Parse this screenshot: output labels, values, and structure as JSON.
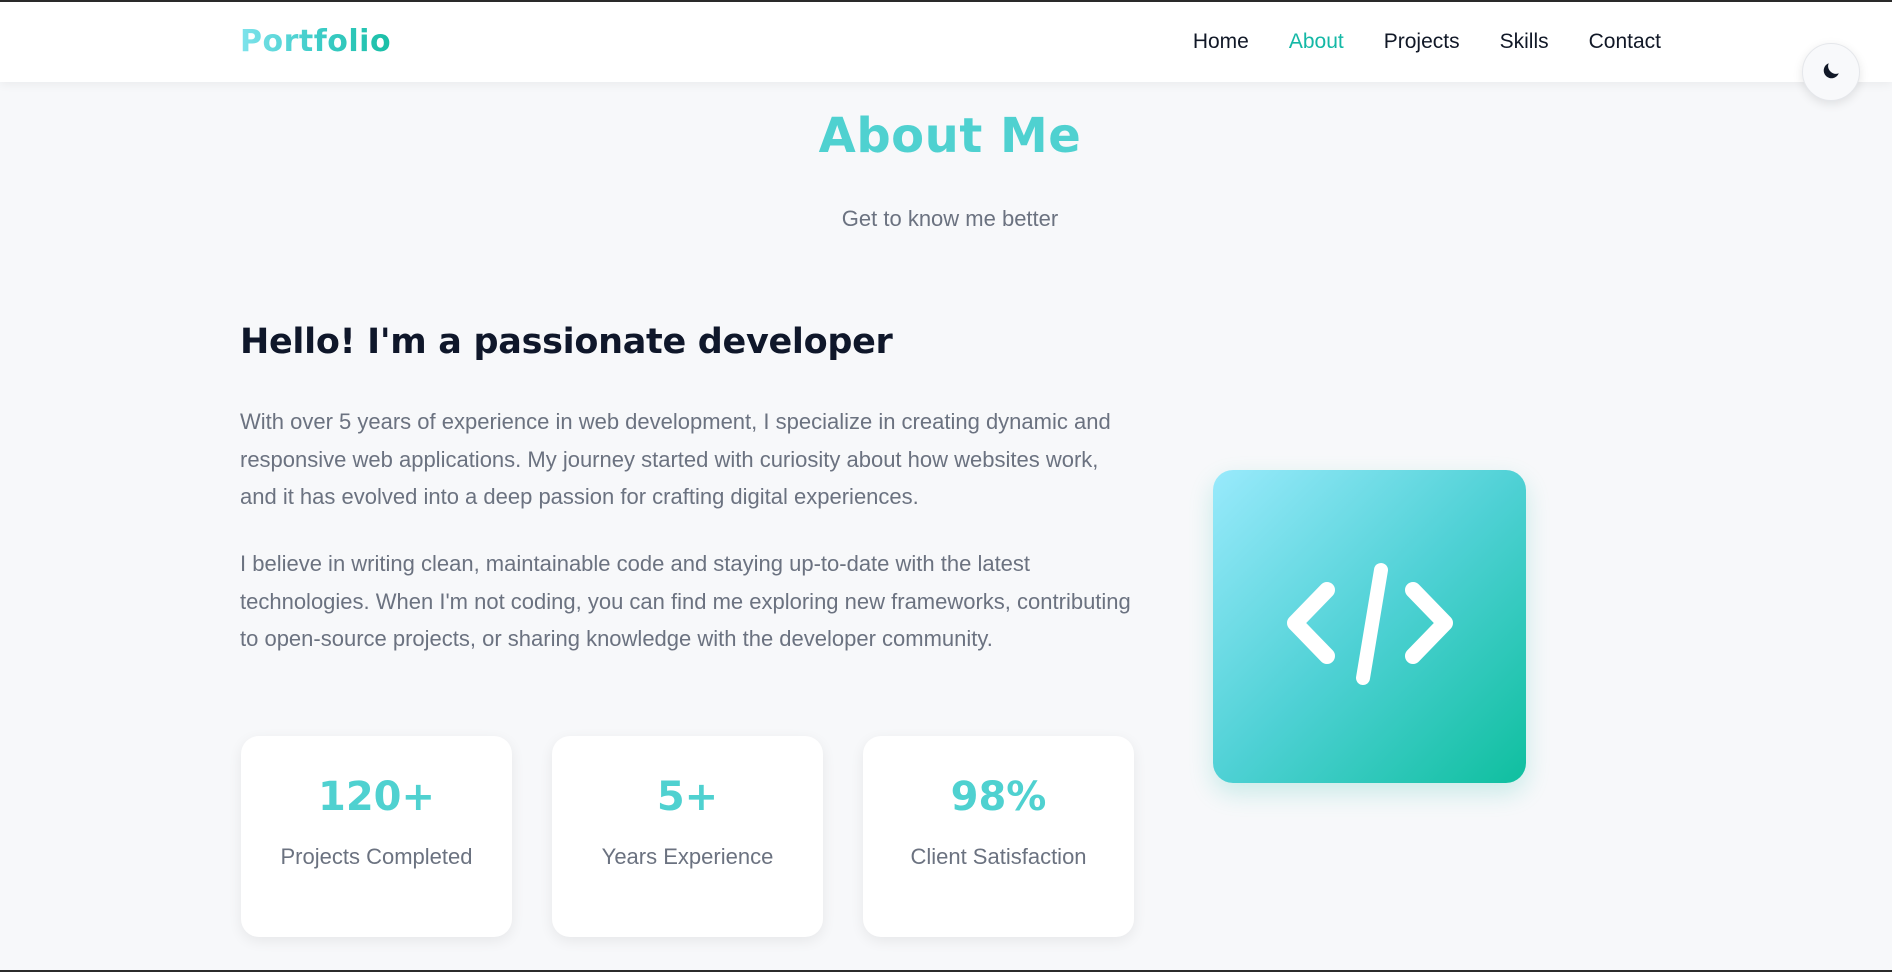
{
  "brand": {
    "logo": "Portfolio"
  },
  "nav": {
    "items": [
      {
        "label": "Home",
        "active": false
      },
      {
        "label": "About",
        "active": true
      },
      {
        "label": "Projects",
        "active": false
      },
      {
        "label": "Skills",
        "active": false
      },
      {
        "label": "Contact",
        "active": false
      }
    ]
  },
  "theme_toggle": {
    "icon": "moon-icon"
  },
  "section": {
    "title": "About Me",
    "subtitle": "Get to know me better"
  },
  "about": {
    "heading": "Hello! I'm a passionate developer",
    "paragraphs": [
      "With over 5 years of experience in web development, I specialize in creating dynamic and responsive web applications. My journey started with curiosity about how websites work, and it has evolved into a deep passion for crafting digital experiences.",
      "I believe in writing clean, maintainable code and staying up-to-date with the latest technologies. When I'm not coding, you can find me exploring new frameworks, contributing to open-source projects, or sharing knowledge with the developer community."
    ],
    "stats": [
      {
        "value": "120+",
        "label": "Projects Completed"
      },
      {
        "value": "5+",
        "label": "Years Experience"
      },
      {
        "value": "98%",
        "label": "Client Satisfaction"
      }
    ],
    "image_icon": "code-icon"
  },
  "colors": {
    "accent": "#4fd1d0",
    "accent_dark": "#14b8a6",
    "text_dark": "#0f172a",
    "text_muted": "#6b7280",
    "background": "#f7f8fa"
  }
}
